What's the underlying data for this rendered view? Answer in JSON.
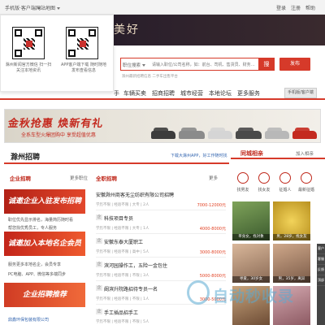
{
  "topbar": {
    "left": [
      "手机版·客户端",
      "网站地图"
    ],
    "right": [
      "登录",
      "注册",
      "帮助"
    ]
  },
  "header": {
    "slogan": "美好",
    "qr_left_caption": "滁州新闻官方微信 扫一扫关注本地资讯",
    "qr_right_caption": "APP客户端下载 随时随地发布查看信息",
    "search_category": "职位搜索",
    "search_placeholder": "请输入职位/公司名称，如：前台、司机、售货员、财务…",
    "search_button": "搜",
    "post_button": "发布",
    "hot_words": "滁州最新招聘信息   二手车出售平台"
  },
  "nav": {
    "items": [
      "手",
      "车辆买卖",
      "招商招聘",
      "城市经营",
      "本地论坛",
      "更多服务"
    ],
    "side_button": "手机版/客户端"
  },
  "ad": {
    "headline": "金秋抢惠 焕新有礼",
    "subline": "全系车型火爆团购中 享受超值优惠"
  },
  "section": {
    "title": "滁州招聘",
    "download_link": "下载大滁州APP，好工作随时找"
  },
  "left_column": {
    "heading": "企业招聘",
    "more": "更多职位",
    "tiles": [
      "诚邀企业入驻发布招聘",
      "诚邀加入本地名企会员",
      "企业招聘推荐"
    ],
    "lines": [
      "职位优先显示排名，海量简历随时看",
      "帮您找优秀员工，专人服务",
      "服务更多本地名企，会员专享",
      "PC电脑、APP、微信等多端同步",
      "鼎鑫环保包装有限公司"
    ]
  },
  "center_column": {
    "heading": "全职招聘",
    "more": "更多",
    "jobs": [
      {
        "badge": "",
        "title": "安徽滁州商客无尘纺织有限公司招聘",
        "meta": "学历不限 | 经验不限 | 大专 | 2人",
        "salary": "7000-12000元"
      },
      {
        "badge": "企",
        "title": "科技项目专员",
        "meta": "学历不限 | 经验不限 | 大专 | 1人",
        "salary": "4000-8000元"
      },
      {
        "badge": "企",
        "title": "安徽东泰大厦职工",
        "meta": "学历不限 | 经验不限 | 高中 | 5人",
        "salary": "3000-8000元"
      },
      {
        "badge": "企",
        "title": "滨河园操作工，五险一金包住",
        "meta": "学历不限 | 经验不限 | 不限 | 3人",
        "salary": "5000-8000元"
      },
      {
        "badge": "企",
        "title": "阚滨升院路招待专员一名",
        "meta": "学历不限 | 经验不限 | 不限 | 1人",
        "salary": "3000-5000元"
      },
      {
        "badge": "企",
        "title": "手工插品招手工",
        "meta": "学历不限 | 经验不限 | 不限 | 5人",
        "salary": ""
      }
    ]
  },
  "right_panel": {
    "title": "同城相亲",
    "join": "加入相亲",
    "icons": [
      {
        "label": "找男友"
      },
      {
        "label": "找女友"
      },
      {
        "label": "征婚人"
      },
      {
        "label": "最新征婚"
      }
    ],
    "photos": [
      {
        "caption": "单身女，找对象"
      },
      {
        "caption": "男，28岁，找女友"
      },
      {
        "caption": "寻爱，30岁女"
      },
      {
        "caption": "男，35岁，离异"
      },
      {
        "caption": ""
      },
      {
        "caption": ""
      }
    ]
  },
  "sidebar": {
    "items": [
      "客户",
      "客服",
      "反馈",
      "顶部"
    ]
  },
  "watermark": "自动秒收录",
  "colors": {
    "brand_red": "#d63a2a",
    "salary_orange": "#e24426"
  }
}
